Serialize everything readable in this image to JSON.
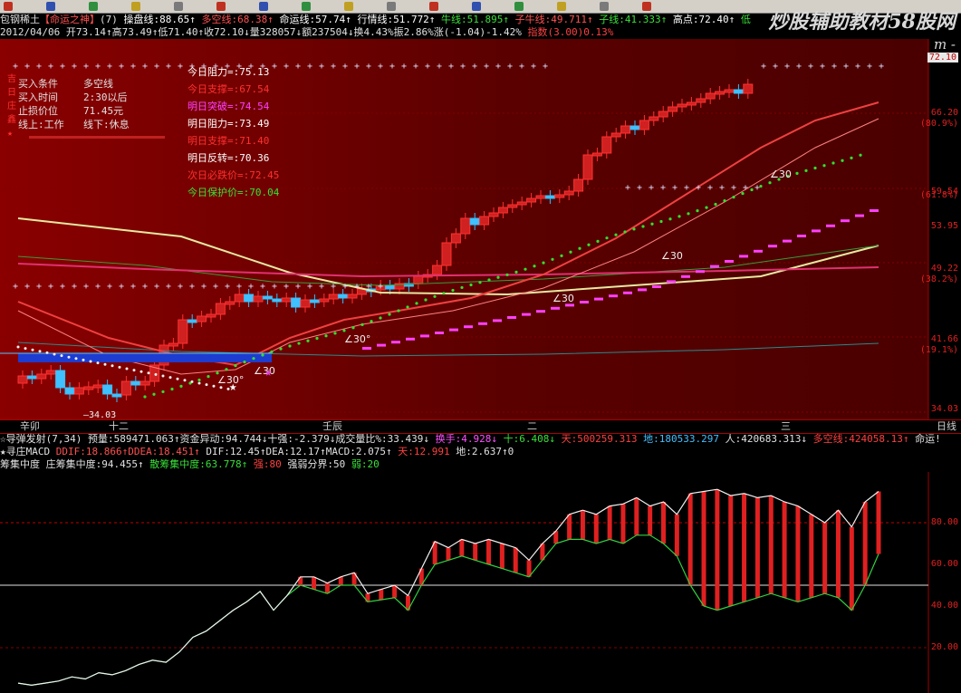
{
  "toolbar": {
    "icons": [
      "arrow-icon",
      "pin-icon",
      "chart-icon",
      "zoom-in-icon",
      "zoom-out-icon",
      "cross-icon",
      "pen-icon",
      "line-icon",
      "bar-icon",
      "fib-icon",
      "arrow-up-icon",
      "text-a-icon",
      "box-icon",
      "circle-icon",
      "grid-icon",
      "save-icon"
    ]
  },
  "info_line_1": {
    "stock": "包钢稀土",
    "indicator": "【命运之神】",
    "params": "(7)",
    "items": [
      {
        "label": "操盘线",
        "value": ":88.65",
        "arrow": "↑",
        "color": "#ffffff"
      },
      {
        "label": "多空线",
        "value": ":68.38",
        "arrow": "↑",
        "color": "#ff5050"
      },
      {
        "label": "命运线",
        "value": ":57.74",
        "arrow": "↑",
        "color": "#ffffff"
      },
      {
        "label": "行情线",
        "value": ":51.772",
        "arrow": "↑",
        "color": "#ffffff"
      },
      {
        "label": "牛线",
        "value": ":51.895",
        "arrow": "↑",
        "color": "#38e038"
      },
      {
        "label": "子牛线",
        "value": ":49.711",
        "arrow": "↑",
        "color": "#ff5050"
      },
      {
        "label": "子线",
        "value": ":41.333",
        "arrow": "↑",
        "color": "#38e038"
      },
      {
        "label": "高点",
        "value": ":72.40",
        "arrow": "↑",
        "color": "#ffffff"
      },
      {
        "label": "低",
        "value": "",
        "arrow": "",
        "color": "#38e038"
      }
    ]
  },
  "info_line_2": {
    "date": "2012/04/06",
    "text": "开73.14↑高73.49↑低71.40↑收72.10↓量328057↓额237504↓换4.43%振2.86%涨(-1.04)-1.42%",
    "extra": "指数(3.00)0.13%"
  },
  "watermark": {
    "title": "炒股辅助教材58股网",
    "url": "- w w w . 5 8 G u . c o m -"
  },
  "price_panel": {
    "yaxis": [
      "72.10",
      "66.20",
      "(80.9%)",
      "59.54",
      "(61.8%)",
      "53.95",
      "49.22",
      "(38.2%)",
      "41.66",
      "(19.1%)",
      "34.03"
    ],
    "low_label": "34.03",
    "angles": [
      "∠30°",
      "∠30°",
      "∠30",
      "∠30",
      "∠30",
      "∠30"
    ],
    "legend": {
      "rows": [
        {
          "label": "买入条件",
          "value": "多空线"
        },
        {
          "label": "买入时间",
          "value": "2:30以后"
        },
        {
          "label": "止损价位",
          "value": "71.45元"
        },
        {
          "label": "线上:工作",
          "value": "线下:休息"
        }
      ],
      "tags": [
        "吉",
        "日",
        "庄",
        "鑫",
        "★"
      ]
    },
    "levels": [
      {
        "text": "今日阻力=:75.13",
        "color": "#ffffff"
      },
      {
        "text": "今日支撑=:67.54",
        "color": "#ff3030"
      },
      {
        "text": "明日突破=:74.54",
        "color": "#ff40ff"
      },
      {
        "text": "明日阻力=:73.49",
        "color": "#ffffff"
      },
      {
        "text": "明日支撑=:71.40",
        "color": "#ff3030"
      },
      {
        "text": "明日反转=:70.36",
        "color": "#ffffff"
      },
      {
        "text": "次日必跌价=:72.45",
        "color": "#ff3030"
      },
      {
        "text": "今日保护价=:70.04",
        "color": "#38e038"
      }
    ],
    "months": [
      "辛卯",
      "十二",
      "壬辰",
      "二",
      "三",
      "日线"
    ]
  },
  "indicator_line_1": [
    {
      "text": "☆导弹发射(7,34) 预量:589471.063↑资金异动:94.744↓十强:-2.379↓成交量比%:33.439↓",
      "color": "#e0e0e0"
    },
    {
      "text": "换手:4.928↓",
      "color": "#ff50ff"
    },
    {
      "text": "十:6.408↓",
      "color": "#38e038"
    },
    {
      "text": "天:500259.313",
      "color": "#ff4040"
    },
    {
      "text": "地:180533.297",
      "color": "#40c0ff"
    },
    {
      "text": "人:420683.313↓",
      "color": "#e0e0e0"
    },
    {
      "text": "多空线:424058.13↑",
      "color": "#ff4040"
    },
    {
      "text": "命运!",
      "color": "#e0e0e0"
    }
  ],
  "indicator_line_2": [
    {
      "text": "★寻庄MACD",
      "color": "#e0e0e0"
    },
    {
      "text": "DDIF:18.866↑DDEA:18.451↑",
      "color": "#ff5050"
    },
    {
      "text": "DIF:12.45↑DEA:12.17↑MACD:2.075↑",
      "color": "#e0e0e0"
    },
    {
      "text": "天:12.991",
      "color": "#ff4040"
    },
    {
      "text": "地:2.637↑0",
      "color": "#e0e0e0"
    }
  ],
  "indicator_line_3": [
    {
      "text": "筹集中度",
      "color": "#e0e0e0"
    },
    {
      "text": "庄筹集中度:94.455↑",
      "color": "#e0e0e0"
    },
    {
      "text": "散筹集中度:63.778↑",
      "color": "#38e038"
    },
    {
      "text": "强:80",
      "color": "#ff4040"
    },
    {
      "text": "强弱分界:50",
      "color": "#e0e0e0"
    },
    {
      "text": "弱:20",
      "color": "#38e038"
    }
  ],
  "chart_data": {
    "type": "line",
    "title": "筹集中度",
    "yaxis_ticks": [
      "80.00",
      "60.00",
      "40.00",
      "20.00"
    ],
    "ylim": [
      0,
      100
    ],
    "thresholds": {
      "strong": 80,
      "divide": 50,
      "weak": 20
    },
    "series": [
      {
        "name": "庄筹集中度",
        "values": [
          3,
          2,
          3,
          4,
          6,
          5,
          8,
          7,
          9,
          12,
          14,
          13,
          18,
          25,
          28,
          33,
          38,
          42,
          47,
          38,
          45,
          54,
          54,
          51,
          54,
          56,
          46,
          48,
          50,
          45,
          58,
          71,
          68,
          72,
          70,
          72,
          70,
          68,
          62,
          70,
          76,
          84,
          86,
          84,
          88,
          89,
          92,
          88,
          90,
          84,
          94,
          95,
          96,
          93,
          94,
          92,
          93,
          90,
          88,
          84,
          80,
          86,
          78,
          90,
          95
        ]
      },
      {
        "name": "散筹集中度",
        "values": [
          3,
          2,
          3,
          4,
          6,
          5,
          8,
          7,
          9,
          12,
          14,
          13,
          18,
          25,
          28,
          33,
          38,
          42,
          47,
          38,
          45,
          50,
          48,
          46,
          50,
          50,
          42,
          43,
          44,
          38,
          50,
          60,
          62,
          64,
          62,
          60,
          58,
          56,
          54,
          62,
          70,
          72,
          72,
          70,
          72,
          70,
          74,
          74,
          70,
          64,
          50,
          40,
          38,
          40,
          42,
          44,
          46,
          44,
          42,
          44,
          46,
          44,
          38,
          50,
          65
        ]
      }
    ]
  }
}
